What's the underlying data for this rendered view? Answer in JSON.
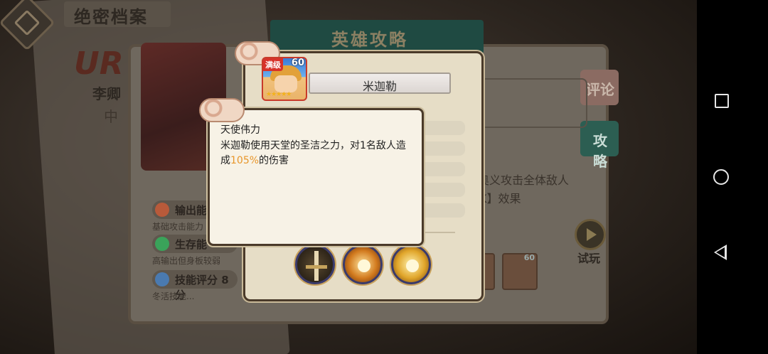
{
  "background": {
    "top_title": "绝密档案",
    "ribbon_title": "英雄攻略",
    "rarity": "UR",
    "side_name": "李卿",
    "side_sub": "中",
    "tabs": [
      "评论",
      "攻略"
    ],
    "stats": [
      {
        "label": "输出能",
        "icon_color": "#b85a3a"
      },
      {
        "label": "生存能",
        "icon_color": "#3aa35a"
      },
      {
        "label": "技能评分  8 分",
        "icon_color": "#4a7ab0"
      }
    ],
    "stat_desc": [
      "基础攻击能力",
      "高输出但身板较弱",
      "冬活技能..."
    ],
    "right_lines": [
      "的奥义攻击全体敌人",
      "K】效果"
    ],
    "trial_label": "试玩",
    "mini_hero_level": "60"
  },
  "modal": {
    "hero_name": "米迦勒",
    "avatar_badge": "满级",
    "avatar_level": "60",
    "avatar_stars": "★★★★★",
    "skills": [
      {
        "name": "sword-skill-icon"
      },
      {
        "name": "radiant-sun-skill-icon"
      },
      {
        "name": "holy-light-skill-icon"
      }
    ]
  },
  "tooltip": {
    "skill_title": "天使伟力",
    "desc_pre": "米迦勒使用天堂的圣洁之力，对1名敌人造成",
    "desc_highlight": "105%",
    "desc_post": "的伤害"
  },
  "colors": {
    "highlight": "#e8962a",
    "strategy_tab": "#2c5e52"
  },
  "navbar": {
    "recents_icon": "square",
    "home_icon": "circle",
    "back_icon": "triangle"
  }
}
